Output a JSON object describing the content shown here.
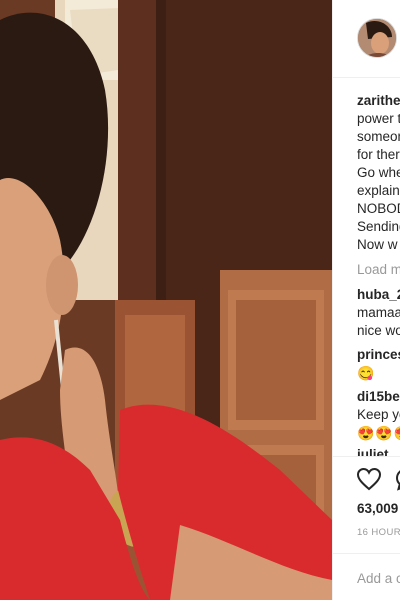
{
  "post": {
    "username": "zarithe",
    "caption_lines": [
      "power t",
      "someon",
      "for ther",
      "Go whe",
      "explain",
      "NOBOD",
      "Sending",
      "Now w"
    ]
  },
  "load_more_label": "Load m",
  "comments": [
    {
      "user": "huba_2",
      "lines": [
        "mamaa",
        "nice wo"
      ]
    },
    {
      "user": "princes",
      "lines": [
        "😋"
      ]
    },
    {
      "user": "di15bec",
      "lines": [
        "Keep yo",
        "😍😍😍"
      ]
    },
    {
      "user": "juliet",
      "lines": []
    }
  ],
  "actions": {
    "like_icon": "heart-icon",
    "comment_icon": "comment-icon"
  },
  "likes_count": "63,009",
  "timestamp": "16 HOURS",
  "add_comment_placeholder": "Add a c",
  "colors": {
    "dress": "#d92b2e",
    "wall": "#5a2e1f",
    "cabinet": "#c9845a"
  }
}
